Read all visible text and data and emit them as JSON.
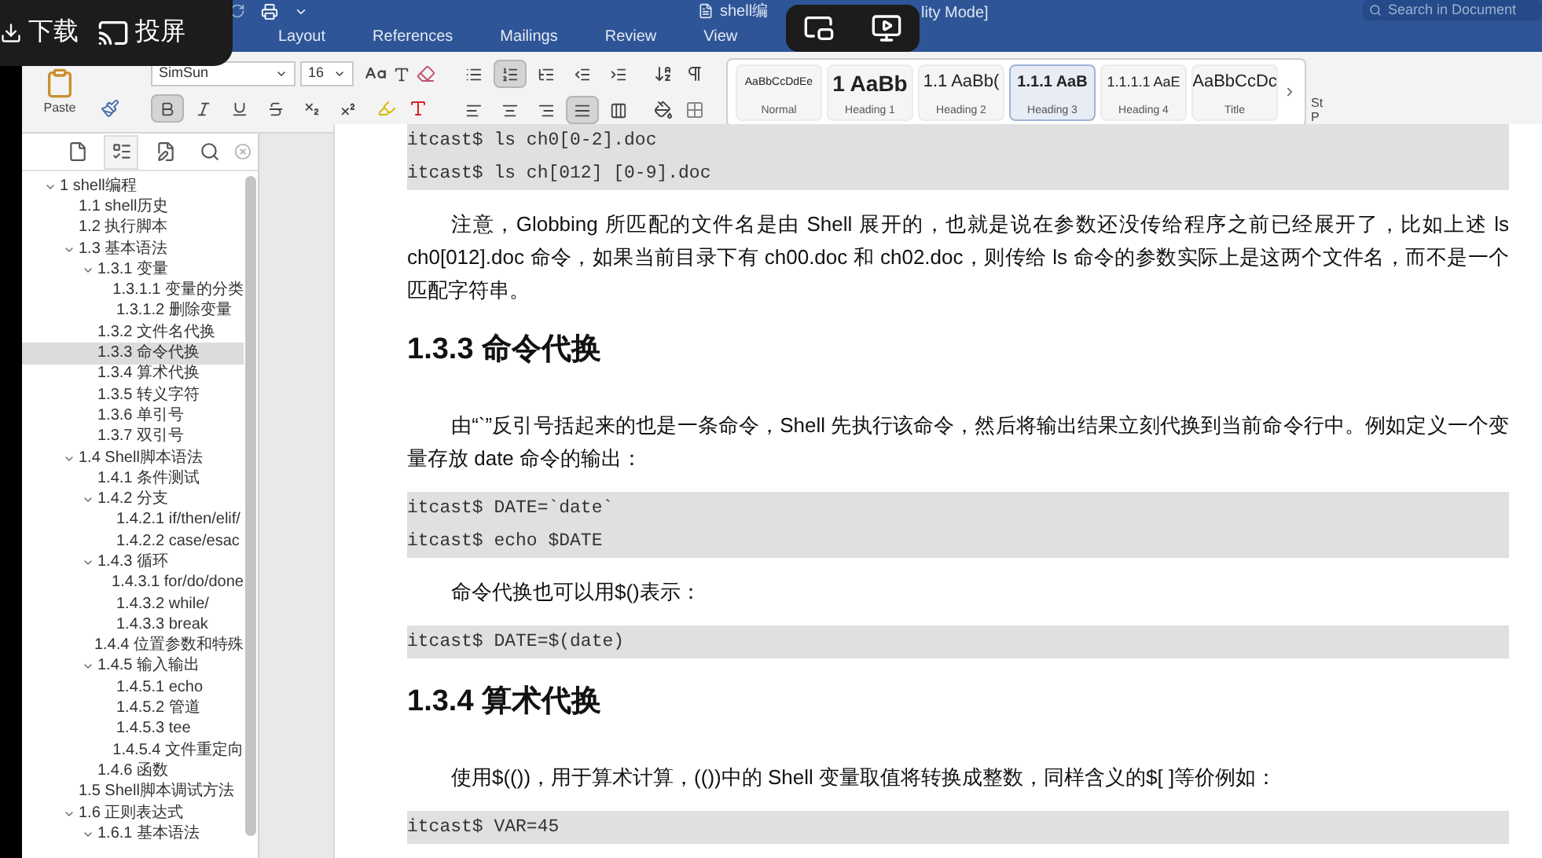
{
  "overlay": {
    "buttons": [
      {
        "kind": "download",
        "label": "下载"
      },
      {
        "kind": "cast",
        "label": "投屏"
      }
    ]
  },
  "window": {
    "title_start": "shell编",
    "title_end": "lity Mode]"
  },
  "search": {
    "placeholder": "Search in Document"
  },
  "tabs": [
    {
      "label": "Layout",
      "selected": false
    },
    {
      "label": "References",
      "selected": false
    },
    {
      "label": "Mailings",
      "selected": false
    },
    {
      "label": "Review",
      "selected": false
    },
    {
      "label": "View",
      "selected": false
    }
  ],
  "ribbon": {
    "paste_label": "Paste",
    "font": "SimSun",
    "size": "16",
    "format_buttons": [
      {
        "kind": "bold",
        "on": true
      },
      {
        "kind": "italic",
        "on": false
      },
      {
        "kind": "underline",
        "on": false
      },
      {
        "kind": "strike",
        "on": false
      },
      {
        "kind": "subscript",
        "on": false
      },
      {
        "kind": "superscript",
        "on": false
      }
    ],
    "paragraph_buttons": [
      {
        "kind": "bullets",
        "on": false
      },
      {
        "kind": "numbering",
        "on": true
      },
      {
        "kind": "multilevel",
        "on": false
      },
      {
        "kind": "outdent",
        "on": false
      },
      {
        "kind": "indent",
        "on": false
      },
      {
        "kind": "align-left",
        "on": false
      },
      {
        "kind": "align-center",
        "on": false
      },
      {
        "kind": "align-right",
        "on": false
      },
      {
        "kind": "justify",
        "on": true
      },
      {
        "kind": "distribute",
        "on": false
      }
    ],
    "styles": [
      {
        "kind": "normal",
        "preview": "AaBbCcDdEe",
        "name": "Normal",
        "selected": false
      },
      {
        "kind": "heading1",
        "preview": "1 AaBb",
        "name": "Heading 1",
        "selected": false
      },
      {
        "kind": "heading2",
        "preview": "1.1 AaBb(",
        "name": "Heading 2",
        "selected": false
      },
      {
        "kind": "heading3",
        "preview": "1.1.1 AaB",
        "name": "Heading 3",
        "selected": true
      },
      {
        "kind": "heading4",
        "preview": "1.1.1.1 AaE",
        "name": "Heading 4",
        "selected": false
      },
      {
        "kind": "title",
        "preview": "AaBbCcDc",
        "name": "Title",
        "selected": false
      }
    ],
    "styles_pane": [
      "St",
      "P"
    ]
  },
  "nav": {
    "tabs": [
      {
        "kind": "thumbnails",
        "selected": false
      },
      {
        "kind": "outline",
        "selected": true
      },
      {
        "kind": "changes",
        "selected": false
      },
      {
        "kind": "search",
        "selected": false
      }
    ],
    "outline": [
      {
        "label": "1 shell编程",
        "expanded": true,
        "selected": false,
        "children": [
          {
            "label": "1.1 shell历史",
            "selected": false
          },
          {
            "label": "1.2 执行脚本",
            "selected": false
          },
          {
            "label": "1.3 基本语法",
            "expanded": true,
            "selected": false,
            "children": [
              {
                "label": "1.3.1 变量",
                "expanded": true,
                "selected": false,
                "children": [
                  {
                    "label": "1.3.1.1 变量的分类",
                    "selected": false
                  },
                  {
                    "label": "1.3.1.2 删除变量",
                    "selected": false
                  }
                ]
              },
              {
                "label": "1.3.2 文件名代换",
                "selected": false
              },
              {
                "label": "1.3.3 命令代换",
                "selected": true
              },
              {
                "label": "1.3.4 算术代换",
                "selected": false
              },
              {
                "label": "1.3.5 转义字符",
                "selected": false
              },
              {
                "label": "1.3.6 单引号",
                "selected": false
              },
              {
                "label": "1.3.7 双引号",
                "selected": false
              }
            ]
          },
          {
            "label": "1.4 Shell脚本语法",
            "expanded": true,
            "selected": false,
            "children": [
              {
                "label": "1.4.1 条件测试",
                "selected": false
              },
              {
                "label": "1.4.2 分支",
                "expanded": true,
                "selected": false,
                "children": [
                  {
                    "label": "1.4.2.1 if/then/elif/",
                    "selected": false
                  },
                  {
                    "label": "1.4.2.2 case/esac",
                    "selected": false
                  }
                ]
              },
              {
                "label": "1.4.3 循环",
                "expanded": true,
                "selected": false,
                "children": [
                  {
                    "label": "1.4.3.1 for/do/done",
                    "selected": false
                  },
                  {
                    "label": "1.4.3.2 while/",
                    "selected": false
                  },
                  {
                    "label": "1.4.3.3 break",
                    "selected": false
                  }
                ]
              },
              {
                "label": "1.4.4 位置参数和特殊",
                "selected": false
              },
              {
                "label": "1.4.5 输入输出",
                "expanded": true,
                "selected": false,
                "children": [
                  {
                    "label": "1.4.5.1 echo",
                    "selected": false
                  },
                  {
                    "label": "1.4.5.2 管道",
                    "selected": false
                  },
                  {
                    "label": "1.4.5.3 tee",
                    "selected": false
                  },
                  {
                    "label": "1.4.5.4 文件重定向",
                    "selected": false
                  }
                ]
              },
              {
                "label": "1.4.6 函数",
                "selected": false
              }
            ]
          },
          {
            "label": "1.5 Shell脚本调试方法",
            "selected": false
          },
          {
            "label": "1.6 正则表达式",
            "expanded": true,
            "selected": false,
            "children": [
              {
                "label": "1.6.1 基本语法",
                "expanded": true,
                "selected": false
              }
            ]
          }
        ]
      }
    ]
  },
  "document": [
    {
      "kind": "code",
      "lines": [
        "itcast$ ls ch0[0-2].doc",
        "itcast$ ls ch[012] [0-9].doc"
      ]
    },
    {
      "kind": "paragraph",
      "text": "注意，Globbing 所匹配的文件名是由 Shell 展开的，也就是说在参数还没传给程序之前已经展开了，比如上述 ls ch0[012].doc 命令，如果当前目录下有 ch00.doc 和 ch02.doc，则传给 ls 命令的参数实际上是这两个文件名，而不是一个匹配字符串。"
    },
    {
      "kind": "heading",
      "text": "1.3.3 命令代换"
    },
    {
      "kind": "paragraph",
      "text": "由“`”反引号括起来的也是一条命令，Shell 先执行该命令，然后将输出结果立刻代换到当前命令行中。例如定义一个变量存放 date 命令的输出："
    },
    {
      "kind": "code",
      "lines": [
        "itcast$ DATE=`date`",
        "itcast$ echo $DATE"
      ]
    },
    {
      "kind": "paragraph",
      "text": "命令代换也可以用$()表示："
    },
    {
      "kind": "code",
      "lines": [
        "itcast$ DATE=$(date)"
      ]
    },
    {
      "kind": "heading",
      "text": "1.3.4 算术代换"
    },
    {
      "kind": "paragraph",
      "text": "使用$(())，用于算术计算，(())中的 Shell 变量取值将转换成整数，同样含义的$[ ]等价例如："
    },
    {
      "kind": "code",
      "lines": [
        "itcast$ VAR=45"
      ]
    }
  ]
}
